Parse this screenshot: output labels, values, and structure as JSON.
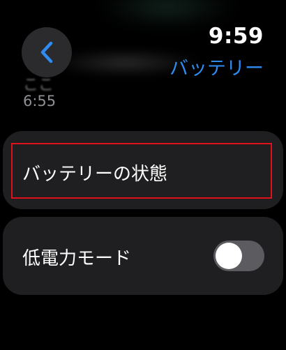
{
  "status": {
    "time": "9:59"
  },
  "nav": {
    "title": "バッテリー",
    "back_icon": "chevron-left-icon"
  },
  "underlay": {
    "blurred_text": "ここ",
    "time": "6:55"
  },
  "settings": {
    "battery_health_label": "バッテリーの状態",
    "low_power_label": "低電力モード",
    "low_power_enabled": false
  },
  "colors": {
    "accent": "#2f8cf0",
    "highlight_border": "#e0111b",
    "card_background": "#1f1f21",
    "toggle_off": "#5b5b60"
  }
}
